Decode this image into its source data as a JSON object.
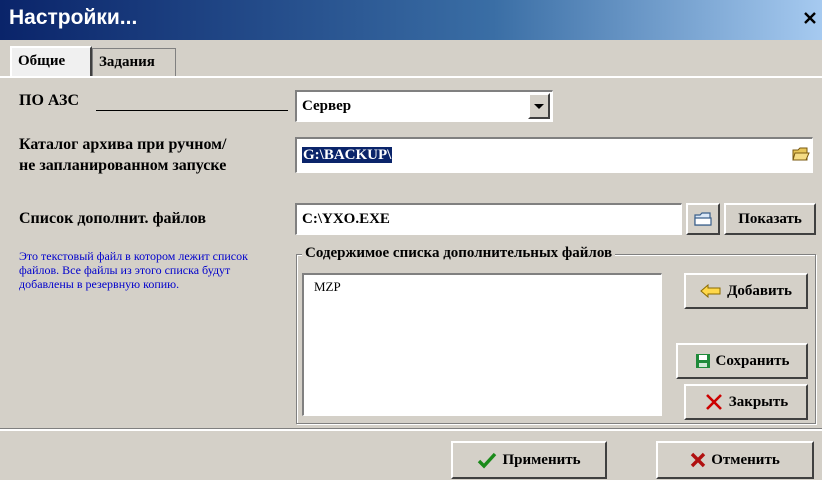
{
  "window": {
    "title": "Настройки...",
    "close_glyph": "✕"
  },
  "tabs": [
    {
      "label": "Общие",
      "active": true
    },
    {
      "label": "Задания",
      "active": false
    }
  ],
  "fields": {
    "azs_label": "ПО АЗС",
    "azs_value": "Сервер",
    "archive_label_line1": "Каталог архива при ручном/",
    "archive_label_line2": "не запланированном запуске",
    "archive_value": "G:\\BACKUP\\",
    "extra_files_label": "Список дополнит. файлов",
    "extra_files_value": "C:\\YXO.EXE",
    "show_button": "Показать"
  },
  "note": "Это текстовый файл в котором лежит список файлов. Все файлы из этого списка будут добавлены в резервную копию.",
  "group": {
    "title": "Содержимое списка дополнительных файлов",
    "items": [
      "MZP"
    ],
    "add_button": "Добавить",
    "save_button": "Сохранить",
    "close_button": "Закрыть"
  },
  "footer": {
    "apply_button": "Применить",
    "cancel_button": "Отменить"
  },
  "colors": {
    "titlebar": "#0a246a",
    "note_text": "#0000cc",
    "window_bg": "#d4d0c8",
    "apply_check": "#1a8a1a",
    "cancel_x": "#cc0000"
  },
  "icons": {
    "combo": "chevron-down-icon",
    "folder": "folder-icon",
    "open_file": "open-file-icon",
    "add": "arrow-left-icon",
    "save": "floppy-disk-icon",
    "close": "red-x-icon",
    "apply": "checkmark-icon",
    "cancel": "x-icon"
  }
}
